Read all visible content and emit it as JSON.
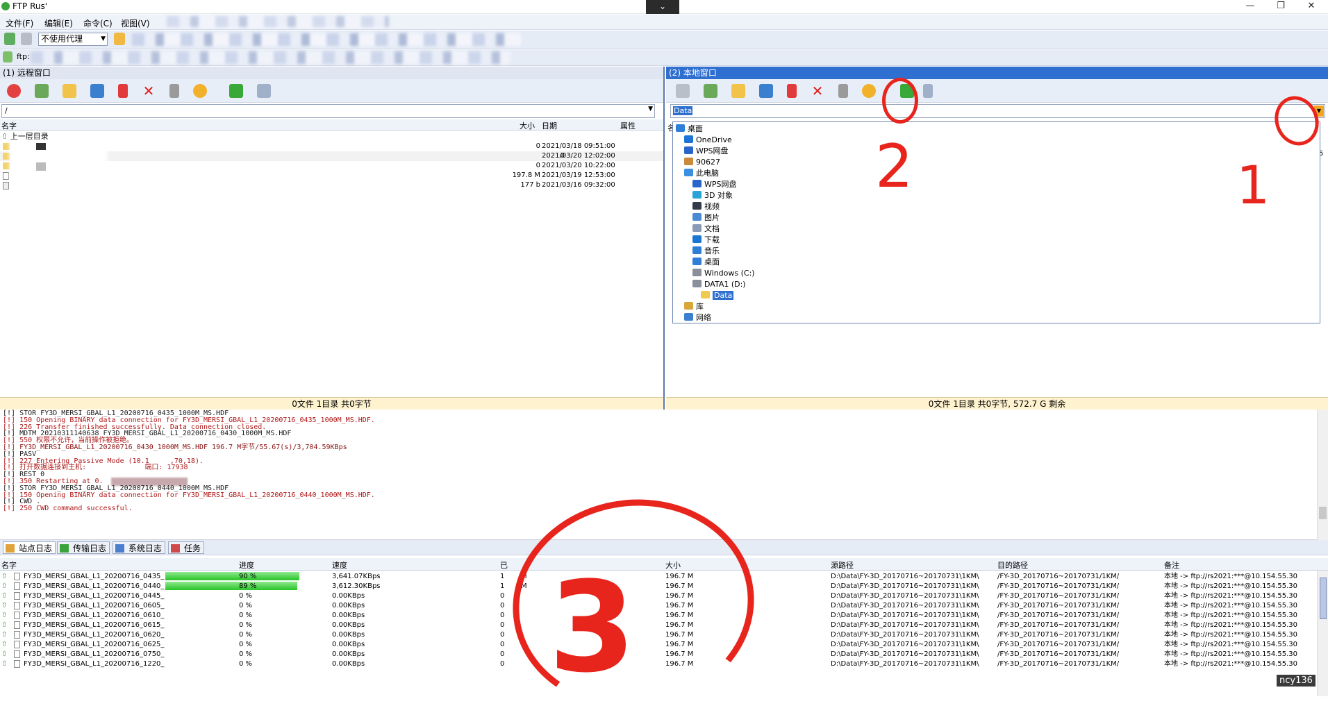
{
  "window": {
    "title": "FTP Rus'",
    "tab_handle": "⌄",
    "min": "—",
    "max": "❐",
    "close": "✕"
  },
  "menu": [
    "文件(F)",
    "编辑(E)",
    "命令(C)",
    "视图(V)"
  ],
  "toolbar": {
    "proxy": "不使用代理",
    "address_prefix": "ftp:"
  },
  "remote": {
    "title": "(1) 远程窗口",
    "path": "/",
    "columns": {
      "name": "名字",
      "size": "大小",
      "date": "日期",
      "attr": "属性"
    },
    "files": [
      {
        "name": "上一层目录",
        "size": "",
        "date": ""
      },
      {
        "name": "",
        "size": "0",
        "date": "2021/03/18 09:51:00"
      },
      {
        "name": "",
        "size": "0",
        "date": "2021/03/20 12:02:00"
      },
      {
        "name": "",
        "size": "0",
        "date": "2021/03/20 10:22:00"
      },
      {
        "name": "",
        "size": "197.8 M",
        "date": "2021/03/19 12:53:00"
      },
      {
        "name": "",
        "size": "177 b",
        "date": "2021/03/16 09:32:00"
      }
    ],
    "status": "0文件 1目录 共0字节"
  },
  "local": {
    "title": "(2) 本地窗口",
    "path": "Data",
    "col_name_partial": "名",
    "tree": [
      {
        "label": "桌面",
        "level": 0,
        "icon": "desktop-icon",
        "color": "#2f7fd8"
      },
      {
        "label": "OneDrive",
        "level": 1,
        "icon": "cloud-icon",
        "color": "#1e73d6"
      },
      {
        "label": "WPS网盘",
        "level": 1,
        "icon": "cloud-icon",
        "color": "#2a66c9"
      },
      {
        "label": "90627",
        "level": 1,
        "icon": "user-icon",
        "color": "#c98a3a"
      },
      {
        "label": "此电脑",
        "level": 1,
        "icon": "computer-icon",
        "color": "#3a8fe0"
      },
      {
        "label": "WPS网盘",
        "level": 2,
        "icon": "cloud-icon",
        "color": "#2a66c9"
      },
      {
        "label": "3D 对象",
        "level": 2,
        "icon": "cube-icon",
        "color": "#29a3d9"
      },
      {
        "label": "视频",
        "level": 2,
        "icon": "video-icon",
        "color": "#333a4a"
      },
      {
        "label": "图片",
        "level": 2,
        "icon": "picture-icon",
        "color": "#4b8bd4"
      },
      {
        "label": "文档",
        "level": 2,
        "icon": "document-icon",
        "color": "#8a9bb5"
      },
      {
        "label": "下载",
        "level": 2,
        "icon": "download-icon",
        "color": "#1b78d2"
      },
      {
        "label": "音乐",
        "level": 2,
        "icon": "music-icon",
        "color": "#2d7fd6"
      },
      {
        "label": "桌面",
        "level": 2,
        "icon": "desktop-icon",
        "color": "#2f7fd8"
      },
      {
        "label": "Windows (C:)",
        "level": 2,
        "icon": "drive-icon",
        "color": "#8a8f99"
      },
      {
        "label": "DATA1 (D:)",
        "level": 2,
        "icon": "drive-icon",
        "color": "#8a8f99"
      },
      {
        "label": "Data",
        "level": 3,
        "icon": "folder-icon",
        "color": "#f0c94f",
        "selected": true
      },
      {
        "label": "库",
        "level": 1,
        "icon": "library-icon",
        "color": "#d9a63a"
      },
      {
        "label": "网络",
        "level": 1,
        "icon": "network-icon",
        "color": "#3a7fd0"
      }
    ],
    "status": "0文件 1目录 共0字节, 572.7 G 剩余",
    "edge_chars": [
      "5"
    ]
  },
  "log": [
    {
      "text": "[!] STOR FY3D_MERSI_GBAL_L1_20200716_0435_1000M_MS.HDF",
      "color": "#1a1a1a"
    },
    {
      "text": "[!] 150 Opening BINARY data connection for FY3D_MERSI_GBAL_L1_20200716_0435_1000M_MS.HDF.",
      "color": "#b01818"
    },
    {
      "text": "[!] 226 Transfer finished successfully. Data connection closed.",
      "color": "#b01818"
    },
    {
      "text": "[!] MDTM 20210311140638 FY3D_MERSI_GBAL_L1_20200716_0430_1000M_MS.HDF",
      "color": "#1a1a1a"
    },
    {
      "text": "[!] 550 权限不允许，当前操作被拒绝。",
      "color": "#b01818"
    },
    {
      "text": "[!] FY3D_MERSI_GBAL_L1_20200716_0430_1000M_MS.HDF 196.7 M字节/55.67(s)/3,704.59KBps",
      "color": "#8a1010"
    },
    {
      "text": "[!] PASV",
      "color": "#1a1a1a"
    },
    {
      "text": "[!] 227 Entering Passive Mode (10.1     ,70,18).",
      "color": "#b01818"
    },
    {
      "text": "[!] 打开数据连接到主机:              端口: 17938",
      "color": "#b01818"
    },
    {
      "text": "[!] REST 0",
      "color": "#1a1a1a"
    },
    {
      "text": "[!] 350 Restarting at 0.",
      "color": "#b01818"
    },
    {
      "text": "[!] STOR FY3D_MERSI_GBAL_L1_20200716_0440_1000M_MS.HDF",
      "color": "#1a1a1a"
    },
    {
      "text": "[!] 150 Opening BINARY data connection for FY3D_MERSI_GBAL_L1_20200716_0440_1000M_MS.HDF.",
      "color": "#b01818"
    },
    {
      "text": "[!] CWD .",
      "color": "#1a1a1a"
    },
    {
      "text": "[!] 250 CWD command successful.",
      "color": "#b01818"
    }
  ],
  "log_tabs": [
    "站点日志",
    "传输日志",
    "系统日志",
    "任务"
  ],
  "queue": {
    "columns": {
      "name": "名字",
      "progress": "进度",
      "speed": "速度",
      "time_partial": "已",
      "size": "大小",
      "src": "源路径",
      "dst": "目的路径",
      "note": "备注"
    },
    "rows": [
      {
        "name": "FY3D_MERSI_GBAL_L1_20200716_0435_",
        "progress": "90 %",
        "pct": 0.9,
        "speed": "3,641.07KBps",
        "time": "1",
        "time2": "M",
        "size": "196.7 M",
        "src": "D:\\Data\\FY-3D_20170716~20170731\\1KM\\",
        "dst": "/FY-3D_20170716~20170731/1KM/",
        "note": "本地 -> ftp://rs2021:***@10.154.55.30"
      },
      {
        "name": "FY3D_MERSI_GBAL_L1_20200716_0440_",
        "progress": "89 %",
        "pct": 0.89,
        "speed": "3,612.30KBps",
        "time": "1",
        "time2": "M",
        "size": "196.7 M",
        "src": "D:\\Data\\FY-3D_20170716~20170731\\1KM\\",
        "dst": "/FY-3D_20170716~20170731/1KM/",
        "note": "本地 -> ftp://rs2021:***@10.154.55.30"
      },
      {
        "name": "FY3D_MERSI_GBAL_L1_20200716_0445_",
        "progress": "0 %",
        "pct": 0,
        "speed": "0.00KBps",
        "time": "0",
        "time2": "",
        "size": "196.7 M",
        "src": "D:\\Data\\FY-3D_20170716~20170731\\1KM\\",
        "dst": "/FY-3D_20170716~20170731/1KM/",
        "note": "本地 -> ftp://rs2021:***@10.154.55.30"
      },
      {
        "name": "FY3D_MERSI_GBAL_L1_20200716_0605_",
        "progress": "0 %",
        "pct": 0,
        "speed": "0.00KBps",
        "time": "0",
        "time2": "",
        "size": "196.7 M",
        "src": "D:\\Data\\FY-3D_20170716~20170731\\1KM\\",
        "dst": "/FY-3D_20170716~20170731/1KM/",
        "note": "本地 -> ftp://rs2021:***@10.154.55.30"
      },
      {
        "name": "FY3D_MERSI_GBAL_L1_20200716_0610_",
        "progress": "0 %",
        "pct": 0,
        "speed": "0.00KBps",
        "time": "0",
        "time2": "",
        "size": "196.7 M",
        "src": "D:\\Data\\FY-3D_20170716~20170731\\1KM\\",
        "dst": "/FY-3D_20170716~20170731/1KM/",
        "note": "本地 -> ftp://rs2021:***@10.154.55.30"
      },
      {
        "name": "FY3D_MERSI_GBAL_L1_20200716_0615_",
        "progress": "0 %",
        "pct": 0,
        "speed": "0.00KBps",
        "time": "0",
        "time2": "",
        "size": "196.7 M",
        "src": "D:\\Data\\FY-3D_20170716~20170731\\1KM\\",
        "dst": "/FY-3D_20170716~20170731/1KM/",
        "note": "本地 -> ftp://rs2021:***@10.154.55.30"
      },
      {
        "name": "FY3D_MERSI_GBAL_L1_20200716_0620_",
        "progress": "0 %",
        "pct": 0,
        "speed": "0.00KBps",
        "time": "0",
        "time2": "",
        "size": "196.7 M",
        "src": "D:\\Data\\FY-3D_20170716~20170731\\1KM\\",
        "dst": "/FY-3D_20170716~20170731/1KM/",
        "note": "本地 -> ftp://rs2021:***@10.154.55.30"
      },
      {
        "name": "FY3D_MERSI_GBAL_L1_20200716_0625_",
        "progress": "0 %",
        "pct": 0,
        "speed": "0.00KBps",
        "time": "0",
        "time2": "",
        "size": "196.7 M",
        "src": "D:\\Data\\FY-3D_20170716~20170731\\1KM\\",
        "dst": "/FY-3D_20170716~20170731/1KM/",
        "note": "本地 -> ftp://rs2021:***@10.154.55.30"
      },
      {
        "name": "FY3D_MERSI_GBAL_L1_20200716_0750_",
        "progress": "0 %",
        "pct": 0,
        "speed": "0.00KBps",
        "time": "0",
        "time2": "",
        "size": "196.7 M",
        "src": "D:\\Data\\FY-3D_20170716~20170731\\1KM\\",
        "dst": "/FY-3D_20170716~20170731/1KM/",
        "note": "本地 -> ftp://rs2021:***@10.154.55.30"
      },
      {
        "name": "FY3D_MERSI_GBAL_L1_20200716_1220_",
        "progress": "0 %",
        "pct": 0,
        "speed": "0.00KBps",
        "time": "0",
        "time2": "",
        "size": "196.7 M",
        "src": "D:\\Data\\FY-3D_20170716~20170731\\1KM\\",
        "dst": "/FY-3D_20170716~20170731/1KM/",
        "note": "本地 -> ftp://rs2021:***@10.154.55.30"
      }
    ]
  },
  "annotations": [
    "1",
    "2",
    "3"
  ],
  "watermark": "ncy136",
  "colors": {
    "accent": "#2a66c9",
    "annotation": "#e8251d",
    "progress": "#28c428"
  }
}
